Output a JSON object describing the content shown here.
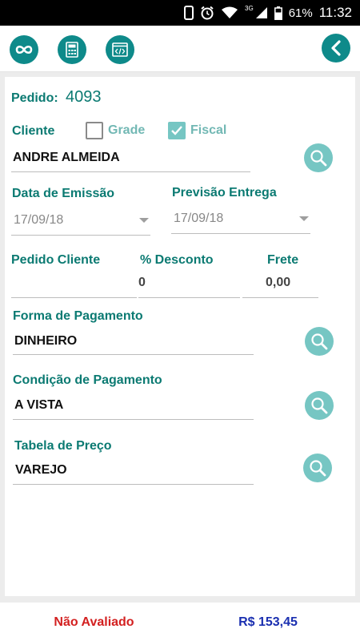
{
  "status_bar": {
    "network": "3G",
    "battery": "61%",
    "time": "11:32",
    "icons": [
      "phone-icon",
      "alarm-icon",
      "wifi-icon",
      "signal-icon",
      "battery-icon"
    ]
  },
  "toolbar": {
    "buttons": [
      "infinity-icon",
      "calculator-icon",
      "code-icon"
    ],
    "back_icon": "chevron-left-icon"
  },
  "form": {
    "pedido_label": "Pedido:",
    "pedido_number": "4093",
    "cliente_label": "Cliente",
    "grade_label": "Grade",
    "grade_checked": false,
    "fiscal_label": "Fiscal",
    "fiscal_checked": true,
    "cliente_value": "ANDRE ALMEIDA",
    "data_emissao_label": "Data de Emissão",
    "data_emissao_value": "17/09/18",
    "previsao_label": "Previsão Entrega",
    "previsao_value": "17/09/18",
    "pedido_cliente_label": "Pedido Cliente",
    "pedido_cliente_value": "",
    "desconto_label": "% Desconto",
    "desconto_value": "0",
    "frete_label": "Frete",
    "frete_value": "0,00",
    "forma_pagamento_label": "Forma de Pagamento",
    "forma_pagamento_value": "DINHEIRO",
    "condicao_label": "Condição de Pagamento",
    "condicao_value": "A VISTA",
    "tabela_label": "Tabela de Preço",
    "tabela_value": "VAREJO"
  },
  "footer": {
    "status": "Não Avaliado",
    "total": "R$ 153,45"
  },
  "colors": {
    "primary": "#0e8a8a",
    "label": "#0b7a72",
    "search_button": "#76c6c3",
    "status_red": "#d32020",
    "total_blue": "#1a2fb0"
  }
}
